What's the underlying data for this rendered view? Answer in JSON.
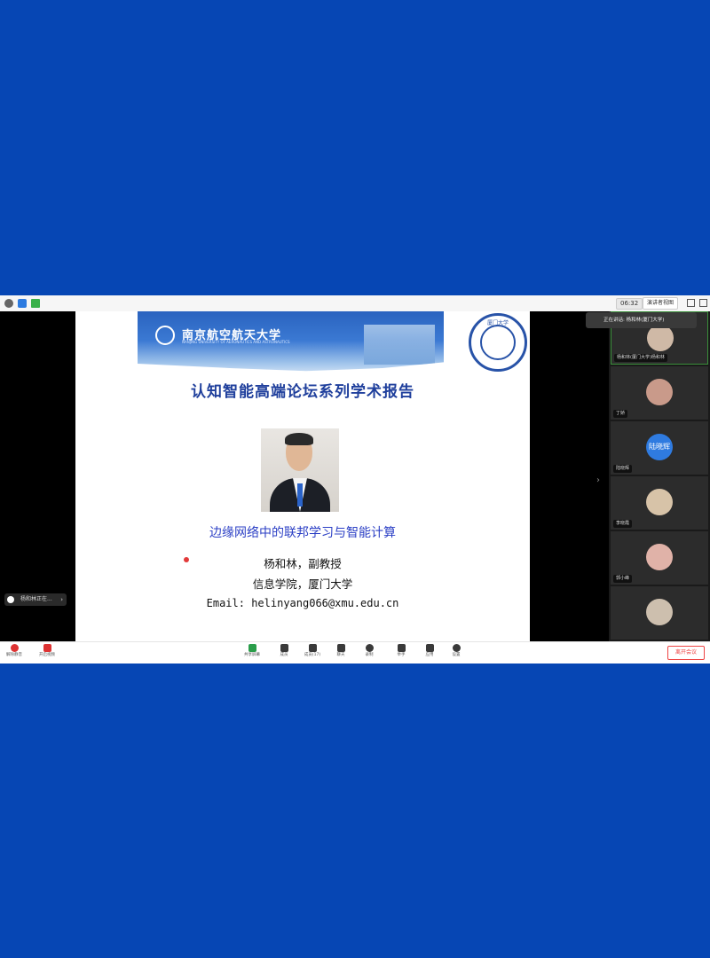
{
  "topbar": {
    "timer": "06:32",
    "view_label": "演讲者视图"
  },
  "slide": {
    "university_name": "南京航空航天大学",
    "university_sub": "NANJING UNIVERSITY OF AERONAUTICS AND ASTRONAUTICS",
    "title": "认知智能高端论坛系列学术报告",
    "seal_text": "厦门大学",
    "talk_title": "边缘网络中的联邦学习与智能计算",
    "speaker": "杨和林，副教授",
    "affiliation": "信息学院，厦门大学",
    "email": "Email: helinyang066@xmu.edu.cn"
  },
  "share_chip": {
    "label": "杨和林正在..."
  },
  "tooltip": {
    "label": "正在讲话: 杨和林(厦门大学)"
  },
  "participants": [
    {
      "name": "杨和林(厦门大学)杨和林"
    },
    {
      "name": "丁娇"
    },
    {
      "name": "陆晓辉",
      "initials": "陆晓辉"
    },
    {
      "name": "李晓霞"
    },
    {
      "name": "郭小峰"
    },
    {
      "name": ""
    }
  ],
  "toolbar": {
    "mute": "解除静音",
    "video": "开启视频",
    "share": "共享屏幕",
    "members": "成员",
    "manage": "成员(17)",
    "chat": "聊天",
    "record": "录制",
    "hand": "举手",
    "apps": "应用",
    "settings": "设置",
    "leave": "离开会议"
  }
}
